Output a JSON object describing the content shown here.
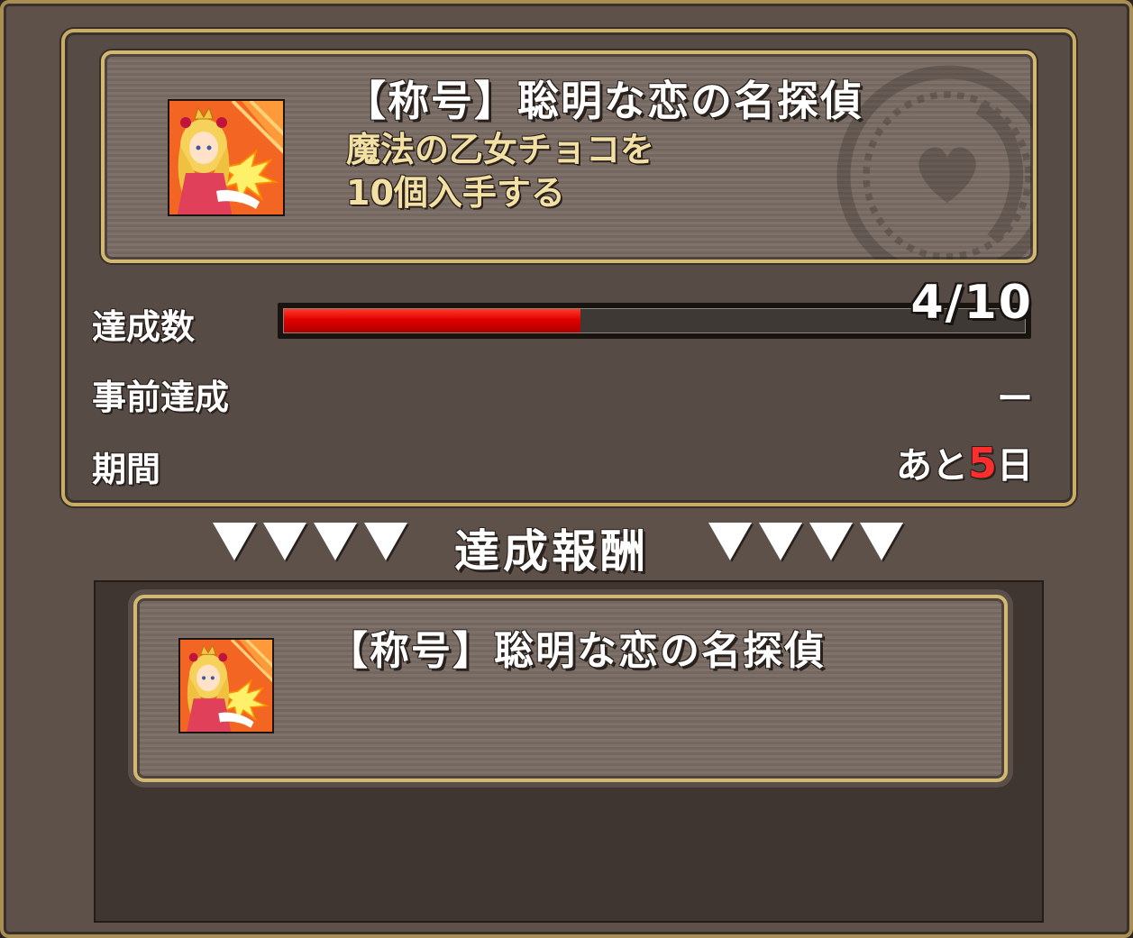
{
  "mission": {
    "title": "【称号】聡明な恋の名探偵",
    "description_line1": "魔法の乙女チョコを",
    "description_line2": "10個入手する",
    "icon": "heroine-portrait-icon"
  },
  "progress": {
    "label": "達成数",
    "count_text": "4/10",
    "current": 4,
    "total": 10,
    "bar_color": "#e00000"
  },
  "pre_achievement": {
    "label": "事前達成",
    "value": "ー"
  },
  "period": {
    "label": "期間",
    "prefix": "あと",
    "days": "5",
    "suffix": "日",
    "accent_color": "#ff2e2e"
  },
  "reward_header": {
    "title": "達成報酬",
    "marker": "▼▼▼▼"
  },
  "reward": {
    "title": "【称号】聡明な恋の名探偵",
    "icon": "heroine-portrait-icon"
  }
}
